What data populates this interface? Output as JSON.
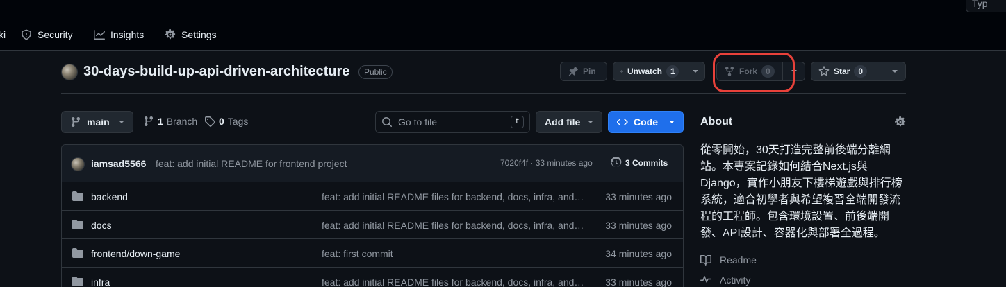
{
  "header": {
    "search_placeholder": "Typ",
    "nav": [
      {
        "label": "ki"
      },
      {
        "label": "Security"
      },
      {
        "label": "Insights"
      },
      {
        "label": "Settings"
      }
    ]
  },
  "repo": {
    "name": "30-days-build-up-api-driven-architecture",
    "visibility": "Public",
    "actions": {
      "pin": "Pin",
      "watch": "Unwatch",
      "watch_count": "1",
      "fork": "Fork",
      "fork_count": "0",
      "star": "Star",
      "star_count": "0"
    }
  },
  "file_nav": {
    "branch": "main",
    "branch_count": "1",
    "branch_label": "Branch",
    "tag_count": "0",
    "tag_label": "Tags",
    "search_placeholder": "Go to file",
    "search_kbd": "t",
    "add_file": "Add file",
    "code": "Code"
  },
  "latest_commit": {
    "author": "iamsad5566",
    "message": "feat: add initial README for frontend project",
    "hash_time": "7020f4f · 33 minutes ago",
    "commits": "3 Commits"
  },
  "files": [
    {
      "name": "backend",
      "message": "feat: add initial README files for backend, docs, infra, and tests",
      "date": "33 minutes ago"
    },
    {
      "name": "docs",
      "message": "feat: add initial README files for backend, docs, infra, and tests",
      "date": "33 minutes ago"
    },
    {
      "name": "frontend/down-game",
      "message": "feat: first commit",
      "date": "34 minutes ago"
    },
    {
      "name": "infra",
      "message": "feat: add initial README files for backend, docs, infra, and tests",
      "date": "33 minutes ago"
    }
  ],
  "about": {
    "title": "About",
    "description": "從零開始，30天打造完整前後端分離網站。本專案記錄如何結合Next.js與Django，實作小朋友下樓梯遊戲與排行榜系統，適合初學者與希望複習全端開發流程的工程師。包含環境設置、前後端開發、API設計、容器化與部署全過程。",
    "links": [
      {
        "label": "Readme",
        "icon": "book-icon"
      },
      {
        "label": "Activity",
        "icon": "pulse-icon"
      }
    ]
  },
  "colors": {
    "background": "#0d1117",
    "primary_button": "#1f6feb",
    "highlight_ring": "#e8413a"
  }
}
